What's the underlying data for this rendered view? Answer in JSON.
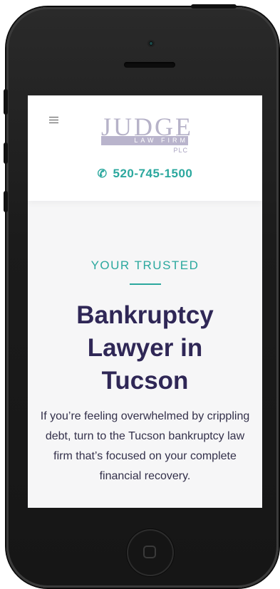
{
  "header": {
    "logo": {
      "word": "JUDGE",
      "sub": "LAW FIRM",
      "suffix": "PLC"
    },
    "phone_number": "520-745-1500",
    "phone_icon": "phone-icon",
    "menu_icon": "hamburger-menu-icon"
  },
  "hero": {
    "eyebrow": "YOUR TRUSTED",
    "headline_line1": "Bankruptcy",
    "headline_line2": "Lawyer in",
    "headline_line3": "Tucson",
    "body": "If you’re feeling overwhelmed by crippling debt, turn to the Tucson bankruptcy law firm that’s focused on your complete financial recovery."
  },
  "colors": {
    "accent": "#2ba89e",
    "heading": "#2f2756",
    "logo": "#b6b2c8"
  }
}
